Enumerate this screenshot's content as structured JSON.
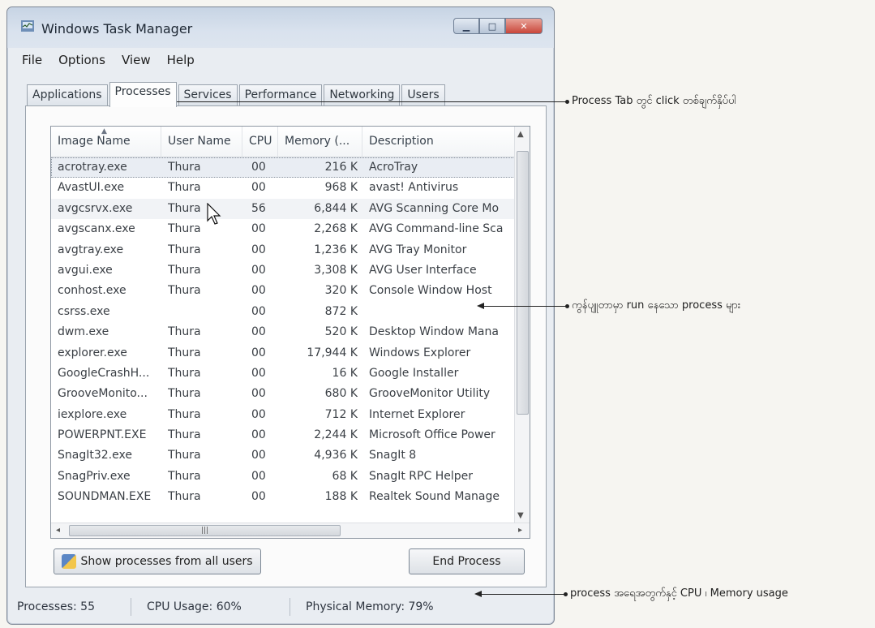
{
  "window": {
    "title": "Windows Task Manager"
  },
  "menu": [
    "File",
    "Options",
    "View",
    "Help"
  ],
  "tabs": [
    "Applications",
    "Processes",
    "Services",
    "Performance",
    "Networking",
    "Users"
  ],
  "columns": [
    "Image Name",
    "User Name",
    "CPU",
    "Memory (...",
    "Description"
  ],
  "rows": [
    [
      "acrotray.exe",
      "Thura",
      "00",
      "216 K",
      "AcroTray"
    ],
    [
      "AvastUI.exe",
      "Thura",
      "00",
      "968 K",
      "avast! Antivirus"
    ],
    [
      "avgcsrvx.exe",
      "Thura",
      "56",
      "6,844 K",
      "AVG Scanning Core Mo"
    ],
    [
      "avgscanx.exe",
      "Thura",
      "00",
      "2,268 K",
      "AVG Command-line Sca"
    ],
    [
      "avgtray.exe",
      "Thura",
      "00",
      "1,236 K",
      "AVG Tray Monitor"
    ],
    [
      "avgui.exe",
      "Thura",
      "00",
      "3,308 K",
      "AVG User Interface"
    ],
    [
      "conhost.exe",
      "Thura",
      "00",
      "320 K",
      "Console Window Host"
    ],
    [
      "csrss.exe",
      "",
      "00",
      "872 K",
      ""
    ],
    [
      "dwm.exe",
      "Thura",
      "00",
      "520 K",
      "Desktop Window Mana"
    ],
    [
      "explorer.exe",
      "Thura",
      "00",
      "17,944 K",
      "Windows Explorer"
    ],
    [
      "GoogleCrashH...",
      "Thura",
      "00",
      "16 K",
      "Google Installer"
    ],
    [
      "GrooveMonito...",
      "Thura",
      "00",
      "680 K",
      "GrooveMonitor Utility"
    ],
    [
      "iexplore.exe",
      "Thura",
      "00",
      "712 K",
      "Internet Explorer"
    ],
    [
      "POWERPNT.EXE",
      "Thura",
      "00",
      "2,244 K",
      "Microsoft Office Power"
    ],
    [
      "SnagIt32.exe",
      "Thura",
      "00",
      "4,936 K",
      "SnagIt 8"
    ],
    [
      "SnagPriv.exe",
      "Thura",
      "00",
      "68 K",
      "SnagIt RPC Helper"
    ],
    [
      "SOUNDMAN.EXE",
      "Thura",
      "00",
      "188 K",
      "Realtek Sound Manage"
    ]
  ],
  "buttons": {
    "show_all": "Show processes from all users",
    "end": "End Process"
  },
  "status": {
    "processes": "Processes: 55",
    "cpu": "CPU Usage: 60%",
    "memory": "Physical Memory: 79%"
  },
  "annotations": [
    "Process Tab တွင် click တစ်ချက်နှိပ်ပါ",
    "ကွန်ပျူတာမှာ run နေသော process များ",
    "process အရေအတွက်နှင့် CPU ၊ Memory usage"
  ],
  "colors": {
    "window_frame": "#7d8796",
    "titlebar": "#c7d4e4",
    "close_button": "#c9463a"
  }
}
